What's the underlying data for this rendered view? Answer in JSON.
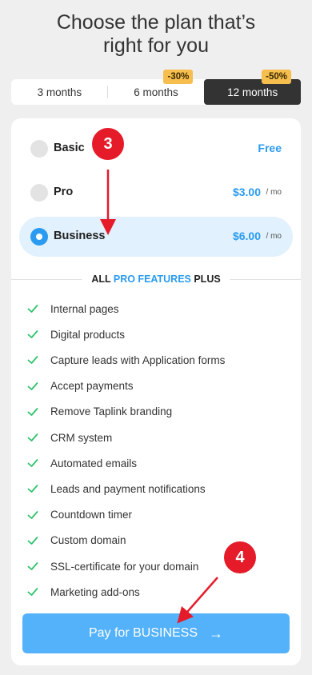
{
  "header": {
    "title_line1": "Choose the plan that’s",
    "title_line2": "right for you"
  },
  "periods": [
    {
      "label": "3 months",
      "discount": "",
      "active": false
    },
    {
      "label": "6 months",
      "discount": "-30%",
      "active": false
    },
    {
      "label": "12 months",
      "discount": "-50%",
      "active": true
    }
  ],
  "plans": [
    {
      "name": "Basic",
      "price": "Free",
      "unit": "",
      "selected": false
    },
    {
      "name": "Pro",
      "price": "$3.00",
      "unit": "/ mo",
      "selected": false
    },
    {
      "name": "Business",
      "price": "$6.00",
      "unit": "/ mo",
      "selected": true
    }
  ],
  "features_header": {
    "prefix": "ALL ",
    "accent": "PRO FEATURES",
    "suffix": " PLUS"
  },
  "features": [
    "Internal pages",
    "Digital products",
    "Capture leads with Application forms",
    "Accept payments",
    "Remove Taplink branding",
    "CRM system",
    "Automated emails",
    "Leads and payment notifications",
    "Countdown timer",
    "Custom domain",
    "SSL-certificate for your domain",
    "Marketing add-ons"
  ],
  "pay_button": {
    "label": "Pay for BUSINESS",
    "arrow": "→"
  },
  "annotations": {
    "step3": "3",
    "step4": "4"
  },
  "colors": {
    "accent": "#2a9bf1",
    "check": "#2ec36b",
    "marker": "#e51b2a",
    "discount": "#f6be4f"
  }
}
